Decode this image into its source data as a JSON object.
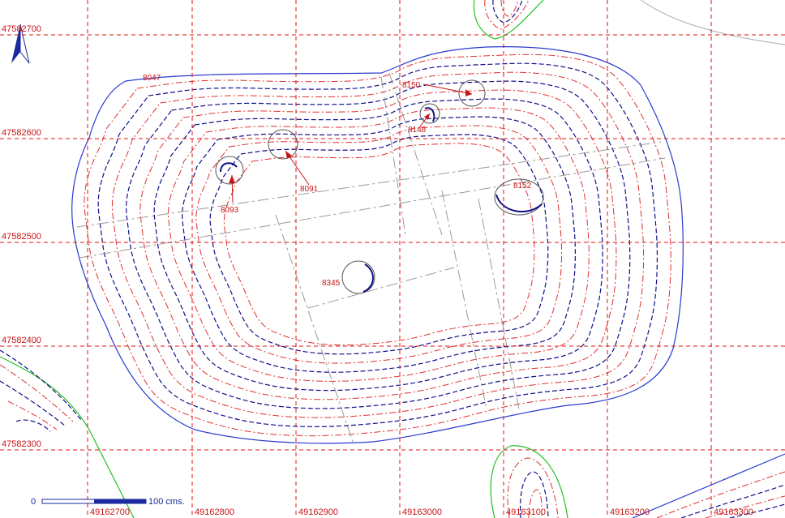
{
  "map": {
    "easting_labels": [
      "49162700",
      "49162800",
      "49162900",
      "49163000",
      "49163100",
      "49163200",
      "49163300"
    ],
    "northing_labels": [
      "47582700",
      "47582600",
      "47582500",
      "47582400",
      "47582300"
    ],
    "features": [
      {
        "id": "8047",
        "label": "8047"
      },
      {
        "id": "8150",
        "label": "8150"
      },
      {
        "id": "8148",
        "label": "8148"
      },
      {
        "id": "8091",
        "label": "8091"
      },
      {
        "id": "8093",
        "label": "8093"
      },
      {
        "id": "8152",
        "label": "8152"
      },
      {
        "id": "8345",
        "label": "8345"
      }
    ],
    "scale": {
      "start_label": "0",
      "end_label": "100 cms."
    },
    "north_arrow": "north-arrow-icon",
    "colors": {
      "grid": "#e01010",
      "contour_red": "#e03030",
      "contour_blue": "#10108a",
      "outline": "#2a3ad0",
      "green_boundary": "#22c022",
      "labels": "#c81414"
    }
  }
}
